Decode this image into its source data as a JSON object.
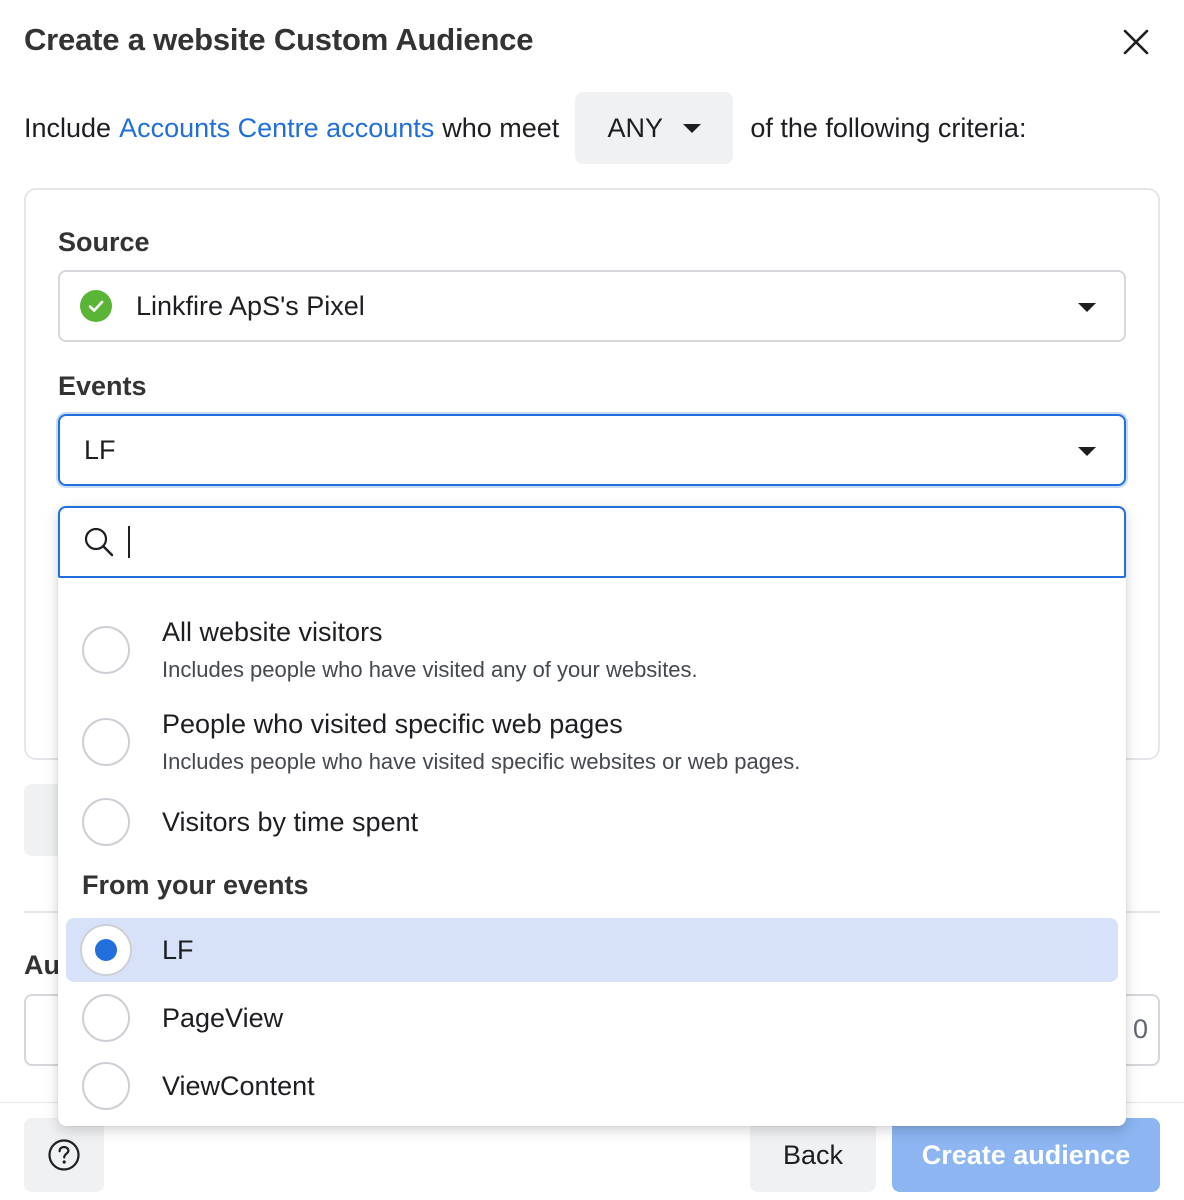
{
  "dialog": {
    "title": "Create a website Custom Audience"
  },
  "criteria": {
    "prefix": "Include",
    "link": "Accounts Centre accounts",
    "middle": "who meet",
    "match_value": "ANY",
    "suffix": "of the following criteria:"
  },
  "source": {
    "label": "Source",
    "value": "Linkfire ApS's Pixel"
  },
  "events": {
    "label": "Events",
    "value": "LF"
  },
  "dropdown": {
    "search_value": "",
    "options": [
      {
        "title": "All website visitors",
        "desc": "Includes people who have visited any of your websites."
      },
      {
        "title": "People who visited specific web pages",
        "desc": "Includes people who have visited specific websites or web pages."
      },
      {
        "title": "Visitors by time spent"
      }
    ],
    "section_heading": "From your events",
    "event_options": [
      {
        "title": "LF",
        "selected": true
      },
      {
        "title": "PageView",
        "selected": false
      },
      {
        "title": "ViewContent",
        "selected": false
      }
    ]
  },
  "audience_name": {
    "label_visible": "Au",
    "counter_visible": "0"
  },
  "footer": {
    "back_label": "Back",
    "create_label": "Create audience"
  },
  "colors": {
    "accent": "#216fdb",
    "success": "#5ab536",
    "selected_row": "#d7e2f8",
    "disabled_primary": "#8cb5f1"
  }
}
